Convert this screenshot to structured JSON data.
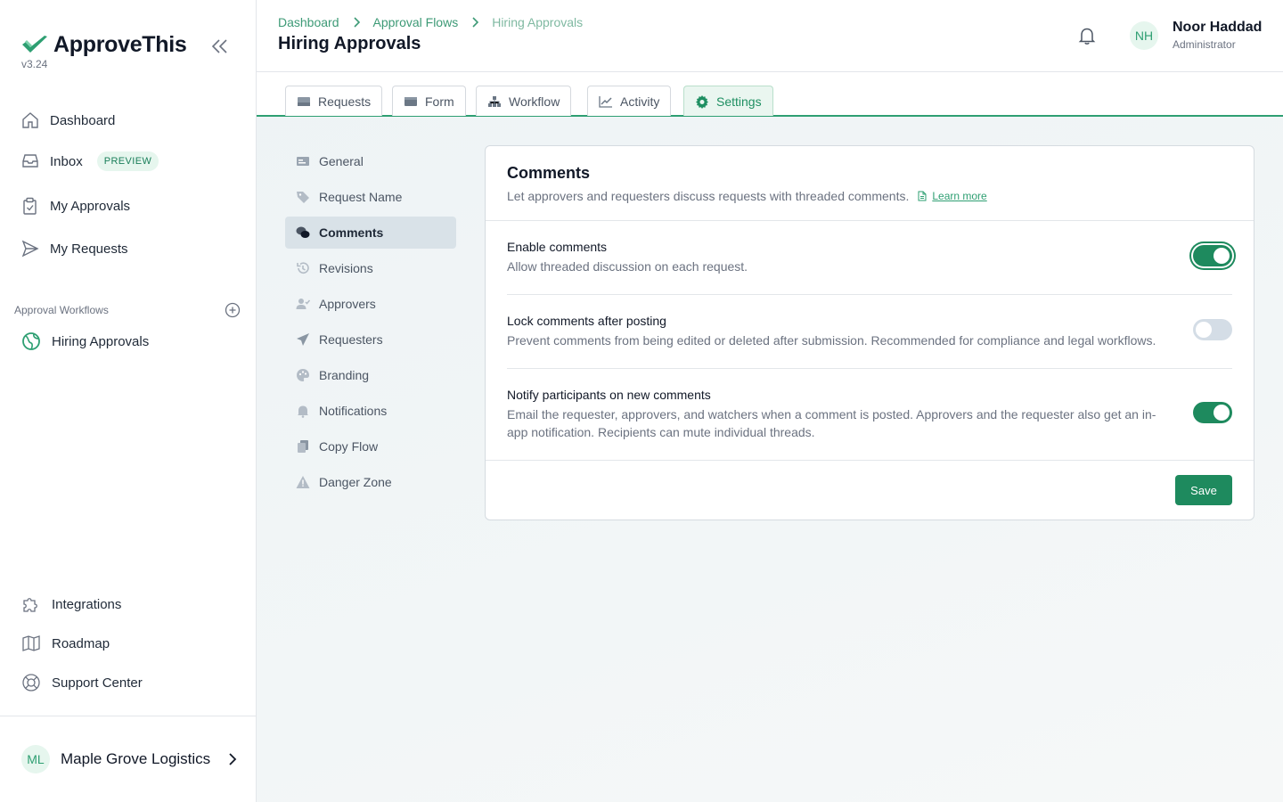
{
  "app": {
    "name": "ApproveThis",
    "version": "v3.24",
    "brand_color": "#2e9f72"
  },
  "sidebar": {
    "collapse_icon": "double-chevron-left-icon",
    "nav": [
      {
        "label": "Dashboard",
        "icon": "home-icon"
      },
      {
        "label": "Inbox",
        "icon": "inbox-icon",
        "badge": "PREVIEW"
      },
      {
        "label": "My Approvals",
        "icon": "clipboard-check-icon"
      },
      {
        "label": "My Requests",
        "icon": "send-icon"
      }
    ],
    "workflows_section_label": "Approval Workflows",
    "workflows": [
      {
        "label": "Hiring Approvals",
        "icon": "globe-icon"
      }
    ],
    "footer_nav": [
      {
        "label": "Integrations",
        "icon": "puzzle-icon"
      },
      {
        "label": "Roadmap",
        "icon": "map-icon"
      },
      {
        "label": "Support Center",
        "icon": "lifebuoy-icon"
      }
    ],
    "org": {
      "initials": "ML",
      "name": "Maple Grove Logistics"
    }
  },
  "header": {
    "breadcrumbs": [
      "Dashboard",
      "Approval Flows",
      "Hiring Approvals"
    ],
    "title": "Hiring Approvals",
    "user": {
      "initials": "NH",
      "name": "Noor Haddad",
      "role": "Administrator"
    }
  },
  "tabs": [
    {
      "label": "Requests",
      "icon": "inbox-tray-icon",
      "active": false
    },
    {
      "label": "Form",
      "icon": "form-icon",
      "active": false
    },
    {
      "label": "Workflow",
      "icon": "sitemap-icon",
      "active": false
    },
    {
      "label": "Activity",
      "icon": "chart-line-icon",
      "active": false
    },
    {
      "label": "Settings",
      "icon": "gear-icon",
      "active": true
    }
  ],
  "settings_menu": [
    {
      "label": "General",
      "icon": "id-card-icon"
    },
    {
      "label": "Request Name",
      "icon": "tag-icon"
    },
    {
      "label": "Comments",
      "icon": "comments-icon",
      "active": true
    },
    {
      "label": "Revisions",
      "icon": "history-icon"
    },
    {
      "label": "Approvers",
      "icon": "user-check-icon"
    },
    {
      "label": "Requesters",
      "icon": "paper-plane-icon"
    },
    {
      "label": "Branding",
      "icon": "palette-icon"
    },
    {
      "label": "Notifications",
      "icon": "bell-icon"
    },
    {
      "label": "Copy Flow",
      "icon": "copy-icon"
    },
    {
      "label": "Danger Zone",
      "icon": "warning-icon"
    }
  ],
  "comments_card": {
    "title": "Comments",
    "description": "Let approvers and requesters discuss requests with threaded comments.",
    "learn_more": "Learn more",
    "settings": [
      {
        "title": "Enable comments",
        "description": "Allow threaded discussion on each request.",
        "enabled": true
      },
      {
        "title": "Lock comments after posting",
        "description": "Prevent comments from being edited or deleted after submission. Recommended for compliance and legal workflows.",
        "enabled": false
      },
      {
        "title": "Notify participants on new comments",
        "description": "Email the requester, approvers, and watchers when a comment is posted. Approvers and the requester also get an in-app notification. Recipients can mute individual threads.",
        "enabled": true
      }
    ],
    "save_label": "Save"
  }
}
